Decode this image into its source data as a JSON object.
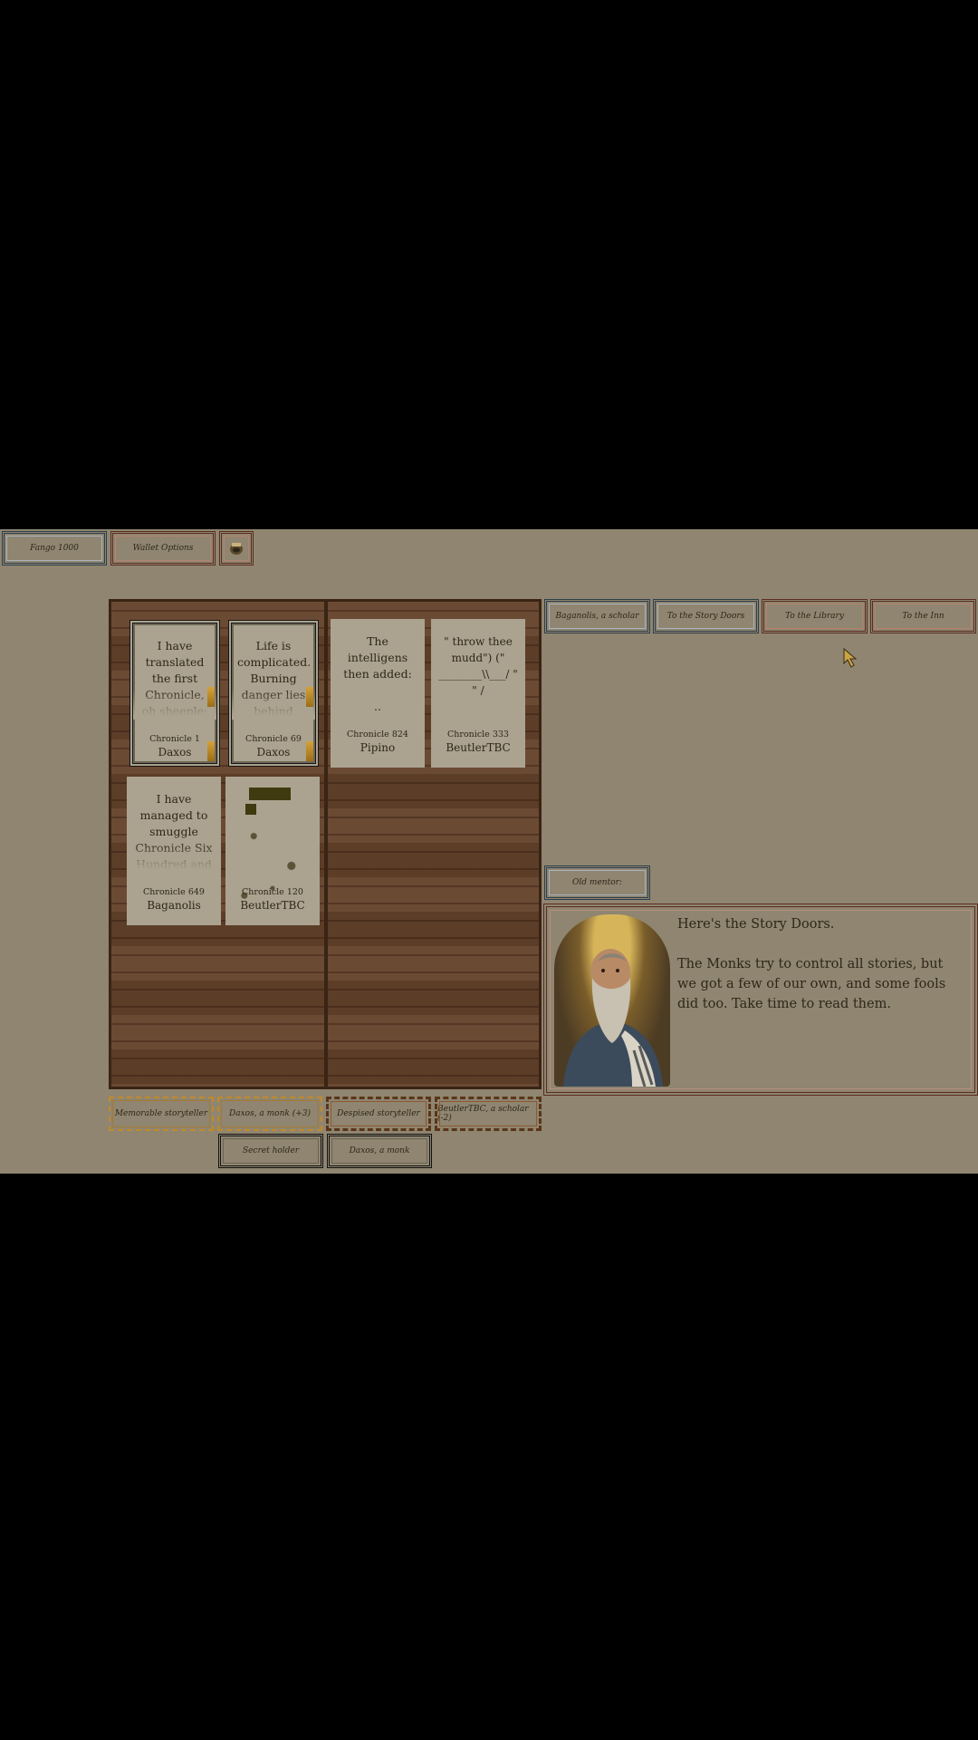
{
  "top_bar": {
    "currency": "Fango 1000",
    "wallet_options": "Wallet Options"
  },
  "nav": {
    "character": "Baganolis, a scholar",
    "story_doors": "To the Story Doors",
    "library": "To the Library",
    "inn": "To the Inn"
  },
  "cards": [
    {
      "text": "I have translated the first Chronicle, oh sheeple:",
      "chronicle": "Chronicle 1",
      "author": "Daxos"
    },
    {
      "text": "Life is complicated. Burning danger lies behind every",
      "chronicle": "Chronicle 69",
      "author": "Daxos"
    },
    {
      "text": "The intelligens then added:\n\n..",
      "chronicle": "Chronicle 824",
      "author": "Pipino"
    },
    {
      "text": "\" throw thee mudd\") (\" ________\\\\___/ \"\n\" /",
      "chronicle": "Chronicle 333",
      "author": "BeutlerTBC"
    },
    {
      "text": "I have managed to smuggle Chronicle Six Hundred and Fourty Nine out",
      "chronicle": "Chronicle 649",
      "author": "Baganolis"
    },
    {
      "text": "",
      "chronicle": "Chronicle 120",
      "author": "BeutlerTBC"
    }
  ],
  "tags": {
    "memorable": "Memorable storyteller",
    "daxos_plus": "Daxos, a monk (+3)",
    "despised": "Despised storyteller",
    "beutler_minus": "BeutlerTBC, a scholar (-2)",
    "secret": "Secret holder",
    "daxos": "Daxos, a monk"
  },
  "dialog": {
    "speaker": "Old mentor:",
    "text": "Here's the Story Doors.\n\nThe Monks try to control all stories, but we got a few of our own, and some fools did too. Take time to read them."
  },
  "colors": {
    "background": "#8f8570",
    "card": "#aba38f",
    "wood": "#6b4a34",
    "gold": "#c18a2a"
  }
}
